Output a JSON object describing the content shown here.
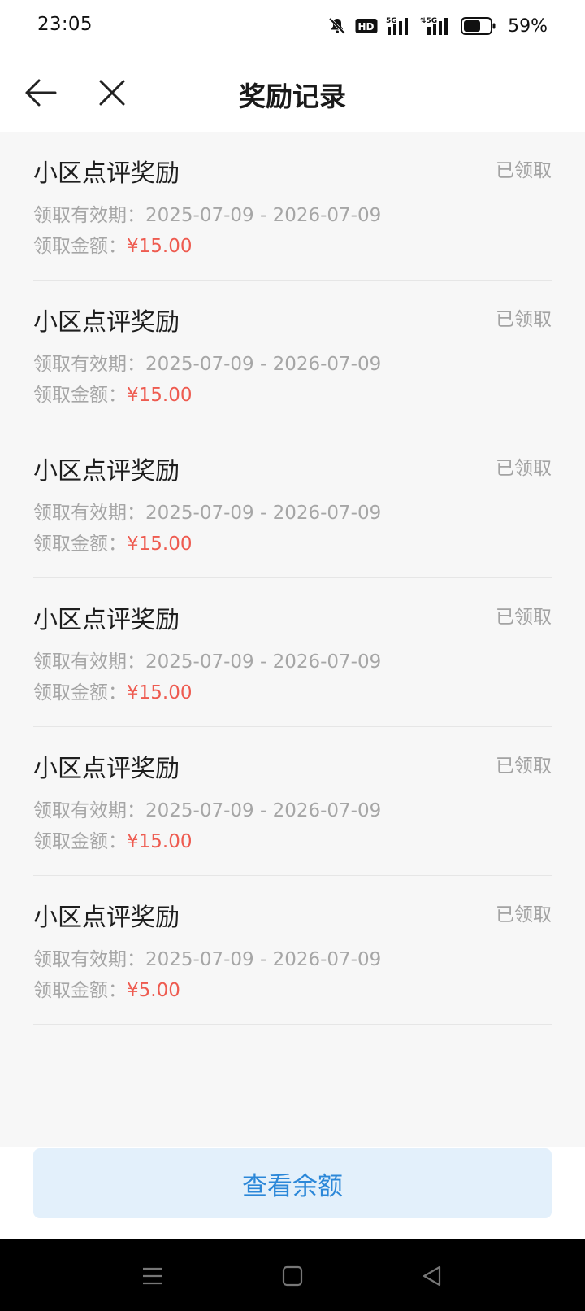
{
  "status_bar": {
    "time": "23:05",
    "icons": [
      "bell-muted-icon",
      "hd-icon",
      "signal-5g-icon",
      "signal-5g-icon",
      "battery-icon"
    ],
    "battery_percent": "59%"
  },
  "header": {
    "title": "奖励记录",
    "back_icon": "arrow-left-icon",
    "close_icon": "close-icon"
  },
  "records": [
    {
      "title": "小区点评奖励",
      "status": "已领取",
      "validity_label": "领取有效期：",
      "validity": "2025-07-09 - 2026-07-09",
      "amount_label": "领取金额：",
      "amount": "¥15.00"
    },
    {
      "title": "小区点评奖励",
      "status": "已领取",
      "validity_label": "领取有效期：",
      "validity": "2025-07-09 - 2026-07-09",
      "amount_label": "领取金额：",
      "amount": "¥15.00"
    },
    {
      "title": "小区点评奖励",
      "status": "已领取",
      "validity_label": "领取有效期：",
      "validity": "2025-07-09 - 2026-07-09",
      "amount_label": "领取金额：",
      "amount": "¥15.00"
    },
    {
      "title": "小区点评奖励",
      "status": "已领取",
      "validity_label": "领取有效期：",
      "validity": "2025-07-09 - 2026-07-09",
      "amount_label": "领取金额：",
      "amount": "¥15.00"
    },
    {
      "title": "小区点评奖励",
      "status": "已领取",
      "validity_label": "领取有效期：",
      "validity": "2025-07-09 - 2026-07-09",
      "amount_label": "领取金额：",
      "amount": "¥15.00"
    },
    {
      "title": "小区点评奖励",
      "status": "已领取",
      "validity_label": "领取有效期：",
      "validity": "2025-07-09 - 2026-07-09",
      "amount_label": "领取金额：",
      "amount": "¥5.00"
    }
  ],
  "bottom": {
    "balance_button_label": "查看余额"
  },
  "colors": {
    "amount": "#ee5b50",
    "button_bg": "#e3f0fb",
    "button_text": "#2b87d8",
    "status_text": "#a3a3a3"
  },
  "nav_bar": {
    "icons": [
      "menu-icon",
      "home-icon",
      "back-triangle-icon"
    ]
  }
}
